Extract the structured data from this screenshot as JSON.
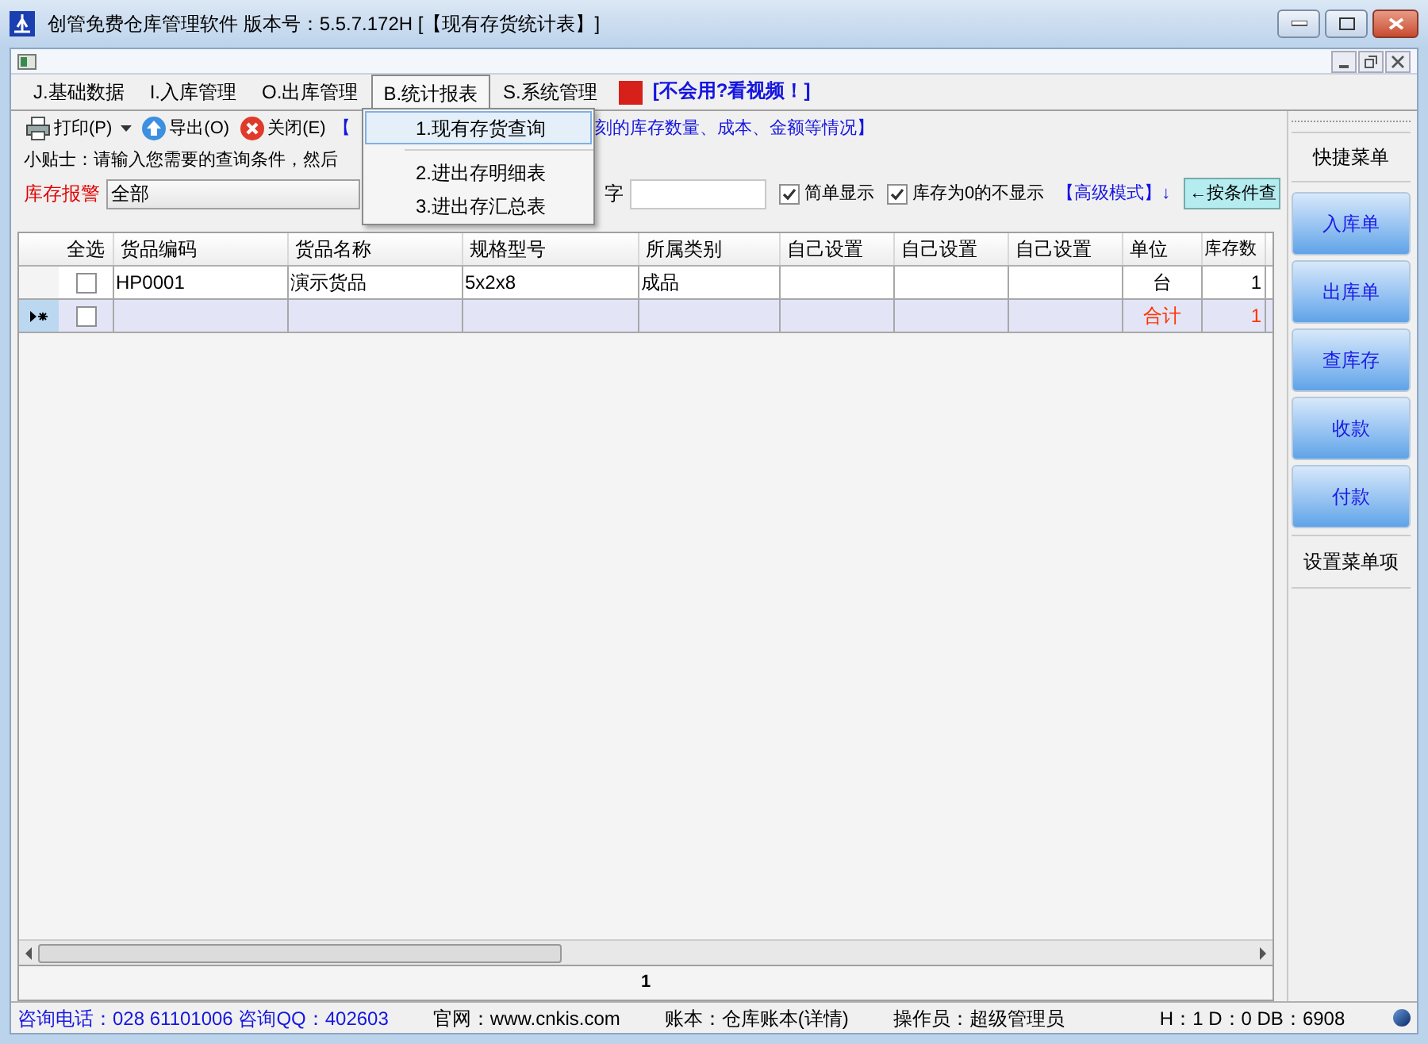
{
  "window": {
    "title": "创管免费仓库管理软件 版本号：5.5.7.172H   [【现有存货统计表】]"
  },
  "menu_bar": [
    {
      "label": "J.基础数据",
      "selected": false
    },
    {
      "label": "I.入库管理",
      "selected": false
    },
    {
      "label": "O.出库管理",
      "selected": false
    },
    {
      "label": "B.统计报表",
      "selected": true
    },
    {
      "label": "S.系统管理",
      "selected": false
    }
  ],
  "help_link": "[不会用?看视频！]",
  "dropdown": [
    {
      "label": "1.现有存货查询",
      "selected": true
    },
    {
      "label": "2.进出存明细表",
      "selected": false
    },
    {
      "label": "3.进出存汇总表",
      "selected": false
    }
  ],
  "toolbar": {
    "buttons": [
      {
        "label": "打印(P)",
        "kind": "print"
      },
      {
        "label": "导出(O)",
        "kind": "export"
      },
      {
        "label": "关闭(E)",
        "kind": "close"
      }
    ],
    "note_start": "【",
    "note_end": "刻的库存数量、成本、金额等情况】"
  },
  "tip": "小贴士：请输入您需要的查询条件，然后",
  "filter": {
    "label": "库存报警",
    "select_value": "全部",
    "keyword_label": "字",
    "checks": [
      {
        "label": "简单显示",
        "checked": true
      },
      {
        "label": "库存为0的不显示",
        "checked": true
      }
    ],
    "advanced_link": "【高级模式】↓",
    "search_button": "←按条件查"
  },
  "table": {
    "columns": [
      "全选",
      "货品编码",
      "货品名称",
      "规格型号",
      "所属类别",
      "自己设置",
      "自己设置",
      "自己设置",
      "单位",
      "库存数"
    ],
    "rows": [
      {
        "kind": "item",
        "current": false,
        "checked": false,
        "code": "HP0001",
        "name": "演示货品",
        "spec": "5x2x8",
        "category": "成品",
        "unit": "台",
        "qty": "1"
      },
      {
        "kind": "total",
        "current": true,
        "checked": false,
        "unit": "合计",
        "qty": "1"
      }
    ]
  },
  "page": "1",
  "sidebar": {
    "title": "快捷菜单",
    "buttons": [
      "入库单",
      "出库单",
      "查库存",
      "收款",
      "付款"
    ],
    "footer": "设置菜单项"
  },
  "status_bar": [
    {
      "kind": "link",
      "text": "咨询电话：028 61101006 咨询QQ：402603"
    },
    {
      "kind": "text",
      "text": "官网：www.cnkis.com"
    },
    {
      "kind": "text",
      "text": "账本：仓库账本(详情)"
    },
    {
      "kind": "text",
      "text": "操作员：超级管理员"
    },
    {
      "kind": "text",
      "text": "H：1 D：0 DB：6908"
    }
  ]
}
